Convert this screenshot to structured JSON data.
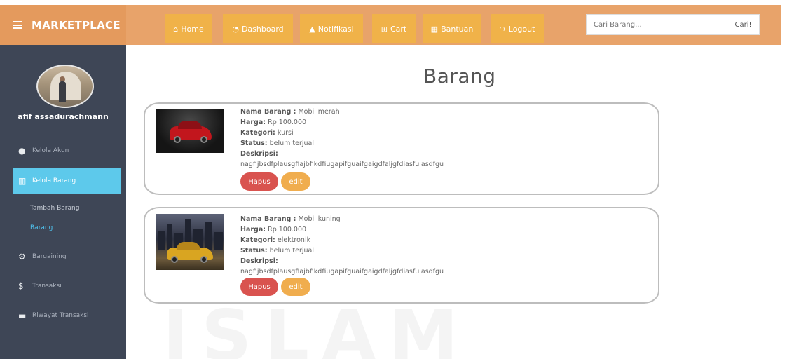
{
  "topbar": {
    "brand": "MARKETPLACE",
    "nav": [
      {
        "label": "Home",
        "icon": "home-icon"
      },
      {
        "label": "Dashboard",
        "icon": "dashboard-icon"
      },
      {
        "label": "Notifikasi",
        "icon": "bell-icon"
      },
      {
        "label": "Cart",
        "icon": "cart-icon"
      },
      {
        "label": "Bantuan",
        "icon": "book-icon"
      },
      {
        "label": "Logout",
        "icon": "logout-icon"
      }
    ],
    "search_placeholder": "Cari Barang...",
    "search_button": "Cari!"
  },
  "sidebar": {
    "username": "afif assadurachmann",
    "items": [
      {
        "label": "Kelola Akun",
        "icon": "user-icon"
      },
      {
        "label": "Kelola Barang",
        "icon": "columns-icon"
      },
      {
        "label": "Bargaining",
        "icon": "gears-icon"
      },
      {
        "label": "Transaksi",
        "icon": "dollar-icon"
      },
      {
        "label": "Riwayat Transaksi",
        "icon": "card-icon"
      }
    ],
    "subitems": [
      {
        "label": "Tambah Barang"
      },
      {
        "label": "Barang"
      }
    ]
  },
  "main": {
    "title": "Barang",
    "labels": {
      "nama": "Nama Barang :",
      "harga": "Harga:",
      "kategori": "Kategori:",
      "status": "Status:",
      "deskripsi": "Deskripsi:"
    },
    "products": [
      {
        "nama": "Mobil merah",
        "harga": "Rp 100.000",
        "kategori": "kursi",
        "status": "belum terjual",
        "deskripsi": "nagfijbsdfplausgfiajbfikdfiugapifguaifgaigdfaljgfdiasfuiasdfgu",
        "hapus": "Hapus",
        "edit": "edit"
      },
      {
        "nama": "Mobil kuning",
        "harga": "Rp 100.000",
        "kategori": "elektronik",
        "status": "belum terjual",
        "deskripsi": "nagfijbsdfplausgfiajbfikdfiugapifguaifgaigdfaljgfdiasfuiasdfgu",
        "hapus": "Hapus",
        "edit": "edit"
      }
    ]
  },
  "watermark": "ISLAM",
  "colors": {
    "topbar": "#e8a36a",
    "nav_button": "#f0b249",
    "sidebar": "#3e4656",
    "sidebar_active": "#5dc9eb",
    "hapus": "#d9534f",
    "edit": "#f0ad4e"
  }
}
